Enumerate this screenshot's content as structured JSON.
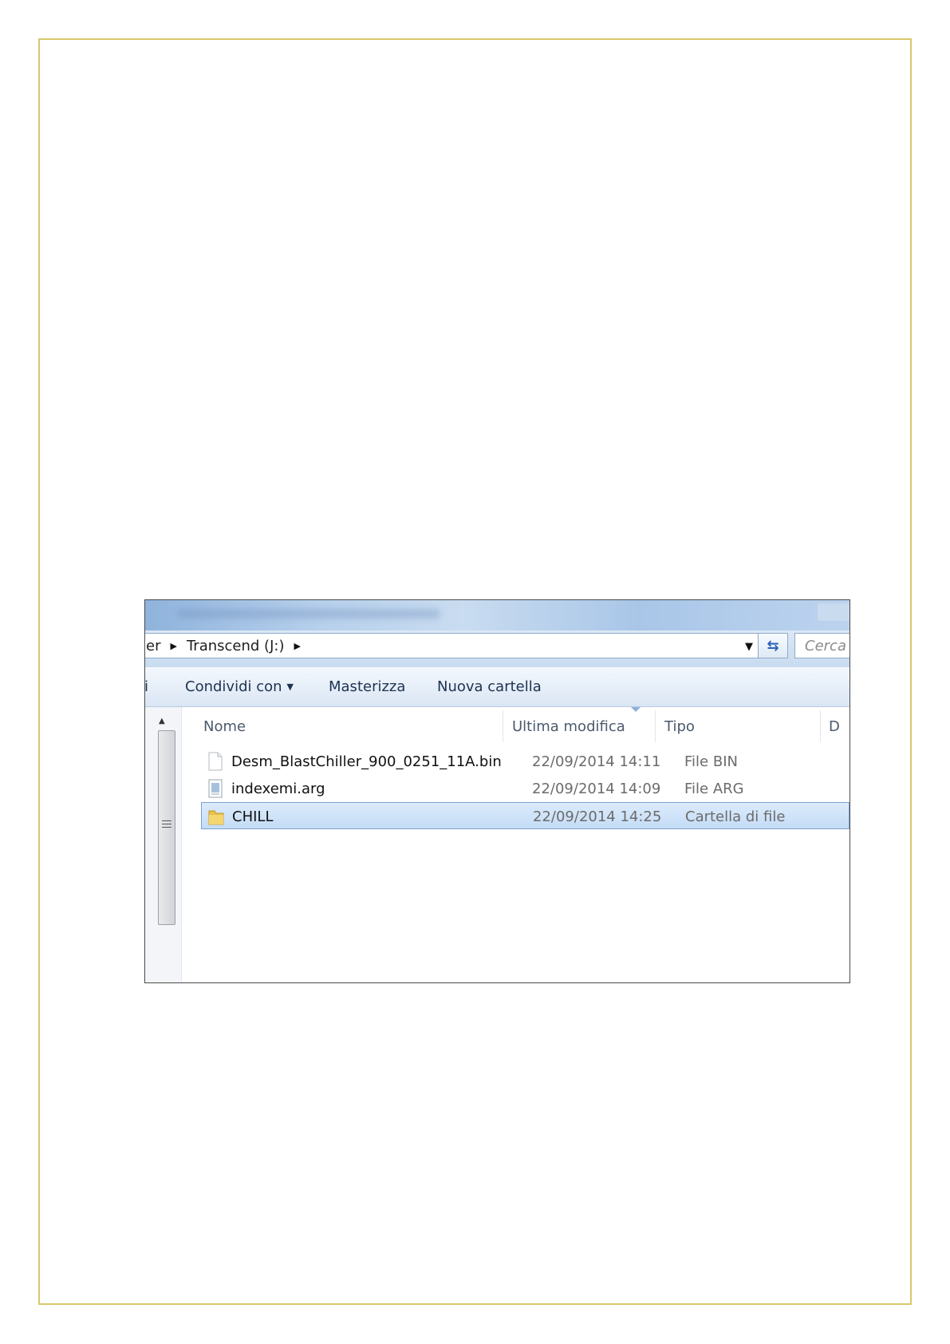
{
  "explorer": {
    "breadcrumb": [
      "er",
      "Transcend (J:)"
    ],
    "search_placeholder": "Cerca T",
    "toolbar": {
      "share_label": "Condividi con",
      "burn_label": "Masterizza",
      "new_folder_label": "Nuova cartella",
      "left_fragment": "i"
    },
    "columns": {
      "name": "Nome",
      "modified": "Ultima modifica",
      "type": "Tipo",
      "size_fragment": "D"
    },
    "files": [
      {
        "name": "Desm_BlastChiller_900_0251_11A.bin",
        "modified": "22/09/2014 14:11",
        "type": "File BIN",
        "icon": "blank-file-icon",
        "selected": false
      },
      {
        "name": "indexemi.arg",
        "modified": "22/09/2014 14:09",
        "type": "File ARG",
        "icon": "text-file-icon",
        "selected": false
      },
      {
        "name": "CHILL",
        "modified": "22/09/2014 14:25",
        "type": "Cartella di file",
        "icon": "folder-icon",
        "selected": true
      }
    ]
  },
  "colors": {
    "page_border": "#d8c86a",
    "selection": "#c4dcf6",
    "accent": "#2c63b8"
  }
}
